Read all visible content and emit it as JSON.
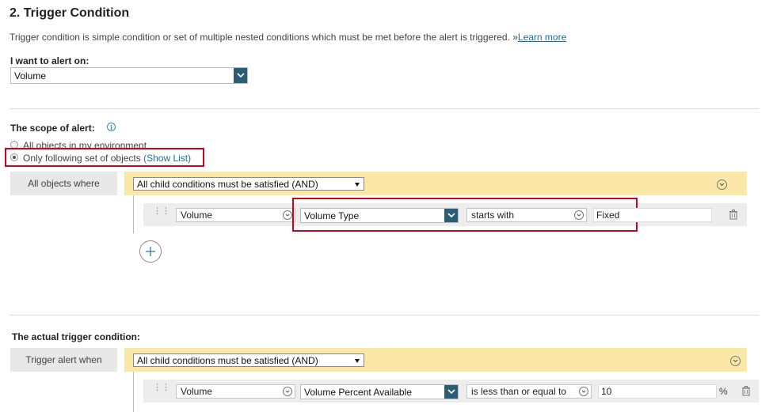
{
  "section": {
    "title": "2. Trigger Condition",
    "description": "Trigger condition is simple condition or set of multiple nested conditions which must be met before the alert is triggered. »",
    "learn_more": "Learn more"
  },
  "alert_on": {
    "label": "I want to alert on:",
    "value": "Volume"
  },
  "scope": {
    "label": "The scope of alert:",
    "option_all": "All objects in my environment",
    "option_following": "Only following set of objects",
    "show_list": "(Show List)",
    "selected": "Only following set of objects",
    "where_label": "All objects where",
    "group_logic": "All child conditions must be satisfied (AND)",
    "condition": {
      "object": "Volume",
      "property": "Volume Type",
      "operator": "starts with",
      "value": "Fixed"
    }
  },
  "trigger": {
    "label": "The actual trigger condition:",
    "when_label": "Trigger alert when",
    "group_logic": "All child conditions must be satisfied (AND)",
    "condition": {
      "object": "Volume",
      "property": "Volume Percent Available",
      "operator": "is less than or equal to",
      "value": "10",
      "unit": "%"
    }
  },
  "icons": [
    "info-icon",
    "chevron-down-icon",
    "grip-icon",
    "trash-icon",
    "add-icon"
  ],
  "colors": {
    "accent": "#2b5d76",
    "link": "#1a6fa0",
    "group_bar": "#fbe8a6",
    "highlight": "#d0021b"
  }
}
